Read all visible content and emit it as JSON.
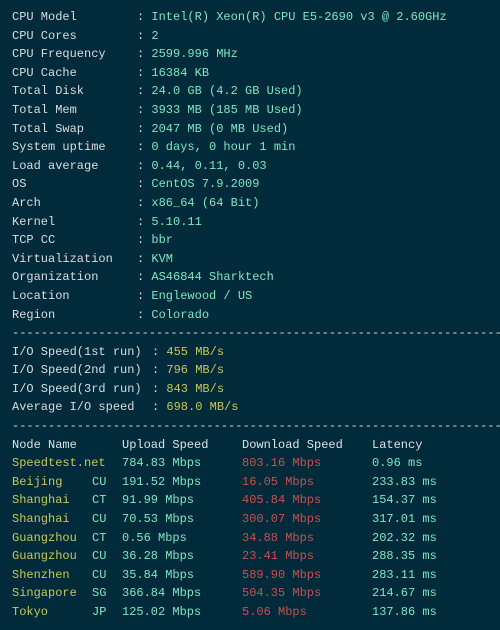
{
  "sysinfo": [
    {
      "label": "CPU Model",
      "value": "Intel(R) Xeon(R) CPU E5-2690 v3 @ 2.60GHz"
    },
    {
      "label": "CPU Cores",
      "value": "2"
    },
    {
      "label": "CPU Frequency",
      "value": "2599.996 MHz"
    },
    {
      "label": "CPU Cache",
      "value": "16384 KB"
    },
    {
      "label": "Total Disk",
      "value": "24.0 GB (4.2 GB Used)"
    },
    {
      "label": "Total Mem",
      "value": "3933 MB (185 MB Used)"
    },
    {
      "label": "Total Swap",
      "value": "2047 MB (0 MB Used)"
    },
    {
      "label": "System uptime",
      "value": "0 days, 0 hour 1 min"
    },
    {
      "label": "Load average",
      "value": "0.44, 0.11, 0.03"
    },
    {
      "label": "OS",
      "value": "CentOS 7.9.2009"
    },
    {
      "label": "Arch",
      "value": "x86_64 (64 Bit)"
    },
    {
      "label": "Kernel",
      "value": "5.10.11"
    },
    {
      "label": "TCP CC",
      "value": "bbr"
    },
    {
      "label": "Virtualization",
      "value": "KVM"
    },
    {
      "label": "Organization",
      "value": "AS46844 Sharktech"
    },
    {
      "label": "Location",
      "value": "Englewood / US"
    },
    {
      "label": "Region",
      "value": "Colorado"
    }
  ],
  "iospeed": [
    {
      "label": "I/O Speed(1st run)",
      "value": "455 MB/s"
    },
    {
      "label": "I/O Speed(2nd run)",
      "value": "796 MB/s"
    },
    {
      "label": "I/O Speed(3rd run)",
      "value": "843 MB/s"
    },
    {
      "label": "Average I/O speed",
      "value": "698.0 MB/s"
    }
  ],
  "speedtest": {
    "headers": {
      "node": "Node Name",
      "upload": "Upload Speed",
      "download": "Download Speed",
      "latency": "Latency"
    },
    "rows": [
      {
        "name": "Speedtest.net",
        "tag": "",
        "up": "784.83 Mbps",
        "down": "803.16 Mbps",
        "lat": "0.96 ms"
      },
      {
        "name": "Beijing",
        "tag": "CU",
        "up": "191.52 Mbps",
        "down": "16.05 Mbps",
        "lat": "233.83 ms"
      },
      {
        "name": "Shanghai",
        "tag": "CT",
        "up": "91.99 Mbps",
        "down": "405.84 Mbps",
        "lat": "154.37 ms"
      },
      {
        "name": "Shanghai",
        "tag": "CU",
        "up": "70.53 Mbps",
        "down": "300.07 Mbps",
        "lat": "317.01 ms"
      },
      {
        "name": "Guangzhou",
        "tag": "CT",
        "up": "0.56 Mbps",
        "down": "34.88 Mbps",
        "lat": "202.32 ms"
      },
      {
        "name": "Guangzhou",
        "tag": "CU",
        "up": "36.28 Mbps",
        "down": "23.41 Mbps",
        "lat": "288.35 ms"
      },
      {
        "name": "Shenzhen",
        "tag": "CU",
        "up": "35.84 Mbps",
        "down": "589.90 Mbps",
        "lat": "283.11 ms"
      },
      {
        "name": "Singapore",
        "tag": "SG",
        "up": "366.84 Mbps",
        "down": "504.35 Mbps",
        "lat": "214.67 ms"
      },
      {
        "name": "Tokyo",
        "tag": "JP",
        "up": "125.02 Mbps",
        "down": "5.06 Mbps",
        "lat": "137.86 ms"
      }
    ]
  },
  "divider": "----------------------------------------------------------------------"
}
